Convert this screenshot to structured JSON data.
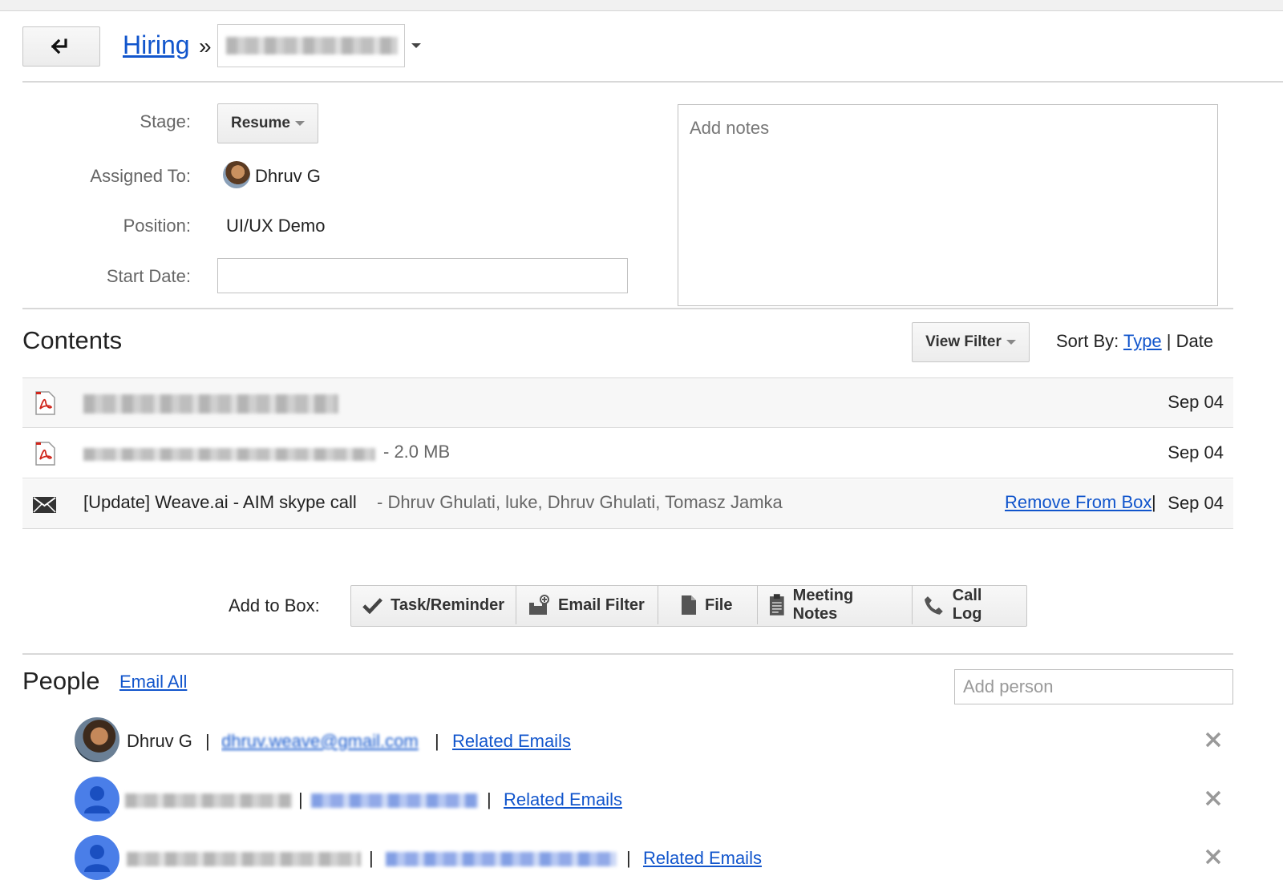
{
  "header": {
    "back_icon": "back-arrow-icon",
    "breadcrumb_link": "Hiring",
    "breadcrumb_separator": "»"
  },
  "details": {
    "stage_label": "Stage:",
    "stage_value": "Resume",
    "assigned_label": "Assigned To:",
    "assigned_value": "Dhruv G",
    "position_label": "Position:",
    "position_value": "UI/UX Demo",
    "start_date_label": "Start Date:",
    "start_date_value": "",
    "notes_placeholder": "Add notes"
  },
  "contents": {
    "title": "Contents",
    "view_filter": "View Filter",
    "sort_label": "Sort By:",
    "sort_type": "Type",
    "sort_sep": "|",
    "sort_date": "Date",
    "rows": [
      {
        "icon": "pdf-icon",
        "size": "",
        "date": "Sep 04"
      },
      {
        "icon": "pdf-icon",
        "size": "- 2.0 MB",
        "date": "Sep 04"
      },
      {
        "icon": "email-icon",
        "subject": "[Update] Weave.ai - AIM skype call",
        "participants": "-  Dhruv Ghulati, luke, Dhruv Ghulati, Tomasz Jamka",
        "action": "Remove From Box",
        "sep": "|",
        "date": "Sep 04"
      }
    ]
  },
  "add_to_box": {
    "label": "Add to Box:",
    "tools": [
      {
        "icon": "checkmark-icon",
        "label": "Task/Reminder"
      },
      {
        "icon": "email-filter-icon",
        "label": "Email Filter"
      },
      {
        "icon": "file-icon",
        "label": "File"
      },
      {
        "icon": "clipboard-icon",
        "label": "Meeting Notes"
      },
      {
        "icon": "phone-icon",
        "label": "Call Log"
      }
    ]
  },
  "people": {
    "title": "People",
    "email_all": "Email All",
    "add_person_placeholder": "Add person",
    "list": [
      {
        "name": "Dhruv G",
        "sep": "|",
        "email": "dhruv.weave@gmail.com",
        "related": "Related Emails"
      },
      {
        "name": "",
        "sep": "|",
        "email": "",
        "related": "Related Emails"
      },
      {
        "name": "",
        "sep": "|",
        "email": "",
        "related": "Related Emails"
      }
    ]
  },
  "colors": {
    "link": "#1155cc",
    "avatar_default": "#4a7ee8"
  }
}
